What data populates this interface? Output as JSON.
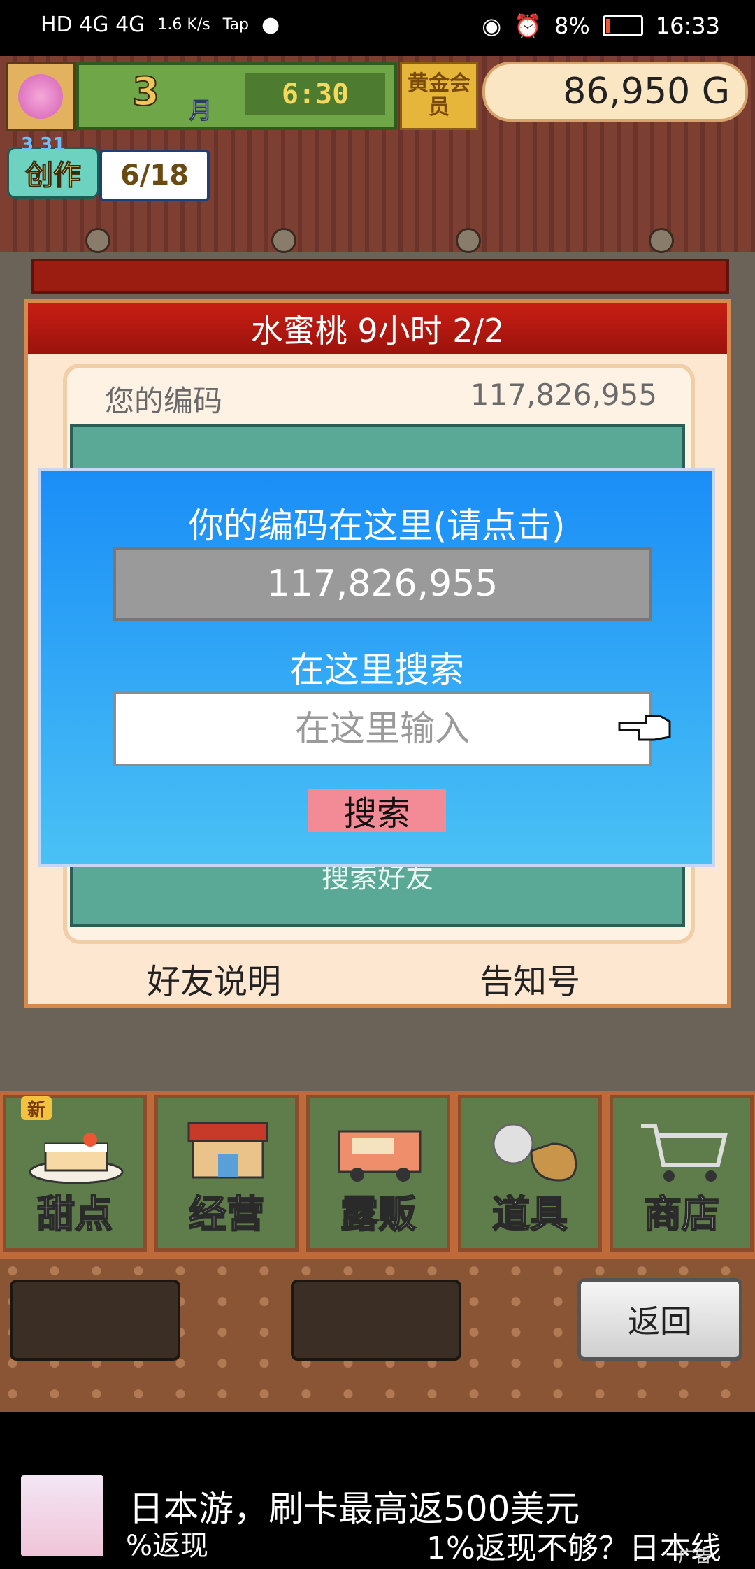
{
  "status_bar": {
    "network": "HD 4G 4G",
    "speed": "1.6 K/s",
    "tap": "Tap",
    "battery": "8%",
    "time": "16:33"
  },
  "hud": {
    "month": "3",
    "month_unit": "月",
    "clock": "6:30",
    "member": "黄金会员",
    "money": "86,950 G",
    "create_label": "创作",
    "create_nums": "3 31",
    "create_progress": "6/18"
  },
  "panel": {
    "title": "水蜜桃  9小时 2/2",
    "your_code_label": "您的编码",
    "your_code_value": "117,826,955",
    "search_friend": "搜索好友",
    "link_help": "好友说明",
    "link_notice": "告知号"
  },
  "dialog": {
    "heading": "你的编码在这里(请点击)",
    "code": "117,826,955",
    "search_heading": "在这里搜索",
    "input_placeholder": "在这里输入",
    "search_button": "搜索"
  },
  "menu": {
    "new_badge": "新",
    "items": [
      {
        "label": "甜点",
        "icon": "cake-icon"
      },
      {
        "label": "经营",
        "icon": "shop-icon"
      },
      {
        "label": "露贩",
        "icon": "food-truck-icon"
      },
      {
        "label": "道具",
        "icon": "item-bag-icon"
      },
      {
        "label": "商店",
        "icon": "shopping-cart-icon"
      }
    ],
    "back": "返回"
  },
  "ad": {
    "title": "日本游，刷卡最高返500美元",
    "sub1": "%返现",
    "sub2": "1%返现不够？日本线",
    "tag": "广告"
  }
}
